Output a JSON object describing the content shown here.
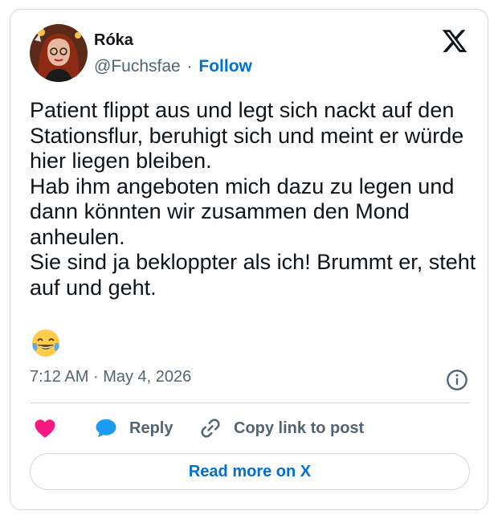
{
  "author": {
    "name": "Róka",
    "handle": "@Fuchsfae",
    "separator": "·",
    "follow_label": "Follow"
  },
  "tweet": {
    "paragraphs": [
      "Patient flippt aus und legt sich nackt auf den Stationsflur, beruhigt sich und meint er würde hier liegen bleiben.",
      "Hab ihm angeboten mich dazu zu legen und dann könnten wir zusammen den Mond anheulen.",
      "Sie sind ja bekloppter als ich! Brummt er, steht auf und geht."
    ],
    "emoji": "face-with-tears-of-joy"
  },
  "meta": {
    "time": "7:12 AM",
    "separator": "·",
    "date": "May 4, 2026"
  },
  "actions": {
    "reply_label": "Reply",
    "copy_label": "Copy link to post"
  },
  "read_more_label": "Read more on X",
  "colors": {
    "like": "#f91880",
    "reply": "#1d9bf0",
    "link": "#006fd6",
    "secondary_text": "#536471",
    "border": "#cfd9de"
  },
  "icons": [
    "x-logo-icon",
    "info-icon",
    "heart-icon",
    "speech-bubble-icon",
    "link-icon"
  ]
}
